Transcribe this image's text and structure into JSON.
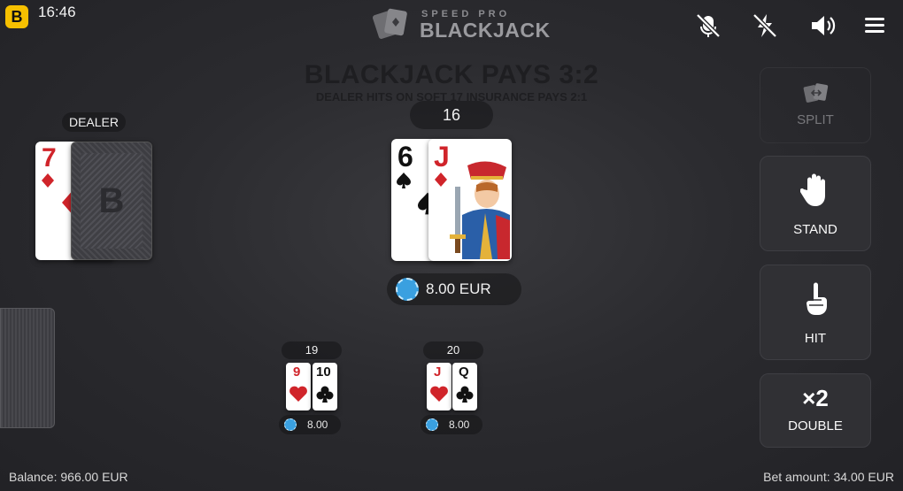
{
  "status": {
    "time": "16:46",
    "app_logo": "B"
  },
  "game_logo": {
    "line1": "SPEED PRO",
    "line2": "BLACKJACK"
  },
  "top_icons": [
    "muted-mic-icon",
    "no-lightning-icon",
    "speaker-icon",
    "menu-icon"
  ],
  "table": {
    "pays": "BLACKJACK PAYS 3:2",
    "rule": "DEALER HITS ON SOFT 17 INSURANCE PAYS 2:1"
  },
  "dealer": {
    "label": "DEALER",
    "cards": [
      {
        "rank": "7",
        "suit": "diamond"
      },
      {
        "face_down": true,
        "back_letter": "B"
      }
    ]
  },
  "player_hand": {
    "total": "16",
    "cards": [
      {
        "rank": "6",
        "suit": "spade"
      },
      {
        "rank": "J",
        "suit": "diamond"
      }
    ],
    "bet": "8.00 EUR"
  },
  "side_hands": [
    {
      "total": "19",
      "cards": [
        {
          "rank": "9",
          "suit": "heart"
        },
        {
          "rank": "10",
          "suit": "club"
        }
      ],
      "bet": "8.00"
    },
    {
      "total": "20",
      "cards": [
        {
          "rank": "J",
          "suit": "heart"
        },
        {
          "rank": "Q",
          "suit": "club"
        }
      ],
      "bet": "8.00"
    }
  ],
  "actions": {
    "split": {
      "label": "SPLIT",
      "enabled": false
    },
    "stand": {
      "label": "STAND",
      "enabled": true
    },
    "hit": {
      "label": "HIT",
      "enabled": true
    },
    "double": {
      "label": "DOUBLE",
      "badge": "×2",
      "enabled": true
    }
  },
  "footer": {
    "balance": "Balance: 966.00 EUR",
    "bet_amount": "Bet amount: 34.00 EUR"
  },
  "colors": {
    "accent_yellow": "#f6c000",
    "chip_blue": "#3aa0e0",
    "card_red": "#d0242a"
  }
}
